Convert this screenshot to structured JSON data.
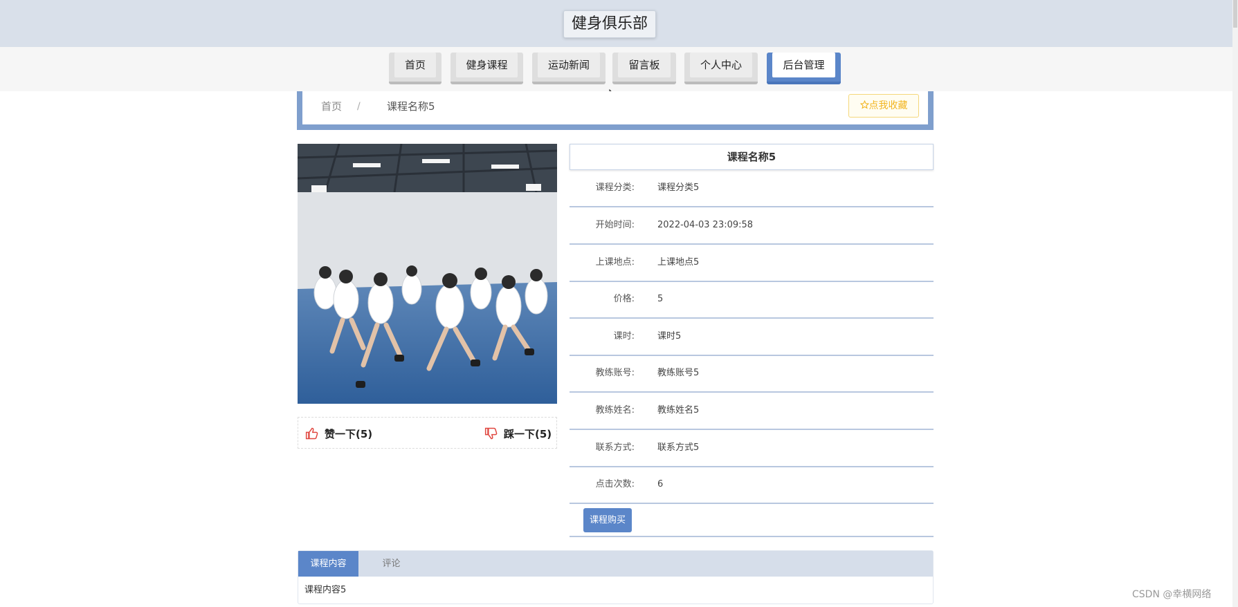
{
  "header": {
    "site_title": "健身俱乐部"
  },
  "nav": {
    "items": [
      {
        "label": "首页"
      },
      {
        "label": "健身课程"
      },
      {
        "label": "运动新闻"
      },
      {
        "label": "留言板"
      },
      {
        "label": "个人中心"
      },
      {
        "label": "后台管理"
      }
    ],
    "active": "后台管理"
  },
  "breadcrumb": {
    "home": "首页",
    "separator": "/",
    "current": "课程名称5"
  },
  "favorite_button": {
    "label": "点我收藏",
    "icon": "star-outline-icon"
  },
  "votes": {
    "like_label": "赞一下(5)",
    "dislike_label": "踩一下(5)",
    "like_icon": "thumbs-up-icon",
    "dislike_icon": "thumbs-down-icon"
  },
  "course": {
    "title": "课程名称5",
    "fields": [
      {
        "key": "课程分类:",
        "value": "课程分类5"
      },
      {
        "key": "开始时间:",
        "value": "2022-04-03 23:09:58"
      },
      {
        "key": "上课地点:",
        "value": "上课地点5"
      },
      {
        "key": "价格:",
        "value": "5"
      },
      {
        "key": "课时:",
        "value": "课时5"
      },
      {
        "key": "教练账号:",
        "value": "教练账号5"
      },
      {
        "key": "教练姓名:",
        "value": "教练姓名5"
      },
      {
        "key": "联系方式:",
        "value": "联系方式5"
      },
      {
        "key": "点击次数:",
        "value": "6"
      }
    ],
    "buy_label": "课程购买"
  },
  "tabs": {
    "items": [
      {
        "label": "课程内容"
      },
      {
        "label": "评论"
      }
    ],
    "active": "课程内容",
    "content": "课程内容5"
  },
  "watermark": "CSDN @幸横网络",
  "colors": {
    "accent": "#5b86c9",
    "header_bg": "#d9e0ea",
    "favorite": "#f2b521",
    "vote_icon": "#e0463f"
  }
}
